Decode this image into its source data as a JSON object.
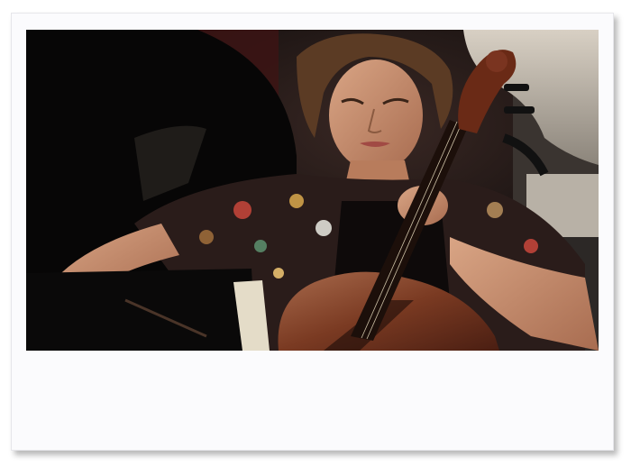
{
  "photo": {
    "subject": "cellist-performing",
    "frame_style": "polaroid-white-border"
  }
}
